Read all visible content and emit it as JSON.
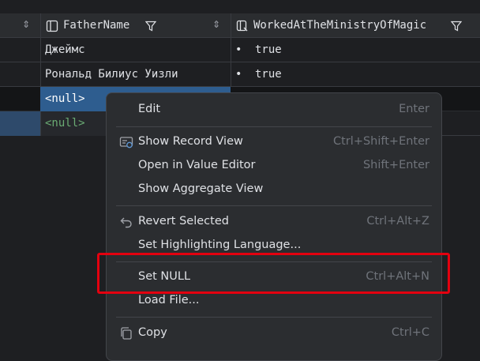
{
  "columns": [
    {
      "sort_icon": "⇕"
    },
    {
      "name": "FatherName",
      "sort_icon": "⇕"
    },
    {
      "name": "WorkedAtTheMinistryOfMagic"
    }
  ],
  "rows": [
    {
      "father": "Джеймс",
      "worked": "true"
    },
    {
      "father": "Рональд Билиус Уизли",
      "worked": "true"
    },
    {
      "father": "<null>",
      "worked": ""
    },
    {
      "father": "<null>",
      "worked": ""
    }
  ],
  "menu": {
    "items": [
      {
        "label": "Edit",
        "shortcut": "Enter"
      },
      {
        "label": "Show Record View",
        "shortcut": "Ctrl+Shift+Enter"
      },
      {
        "label": "Open in Value Editor",
        "shortcut": "Shift+Enter"
      },
      {
        "label": "Show Aggregate View",
        "shortcut": ""
      },
      {
        "label": "Revert Selected",
        "shortcut": "Ctrl+Alt+Z"
      },
      {
        "label": "Set Highlighting Language...",
        "shortcut": ""
      },
      {
        "label": "Set NULL",
        "shortcut": "Ctrl+Alt+N"
      },
      {
        "label": "Load File...",
        "shortcut": ""
      },
      {
        "label": "Copy",
        "shortcut": "Ctrl+C"
      }
    ]
  },
  "colors": {
    "background": "#1e1f22",
    "header": "#2b2d30",
    "selection": "#2e5d8f",
    "null_green": "#6aab73",
    "highlight_red": "#e3000f"
  }
}
